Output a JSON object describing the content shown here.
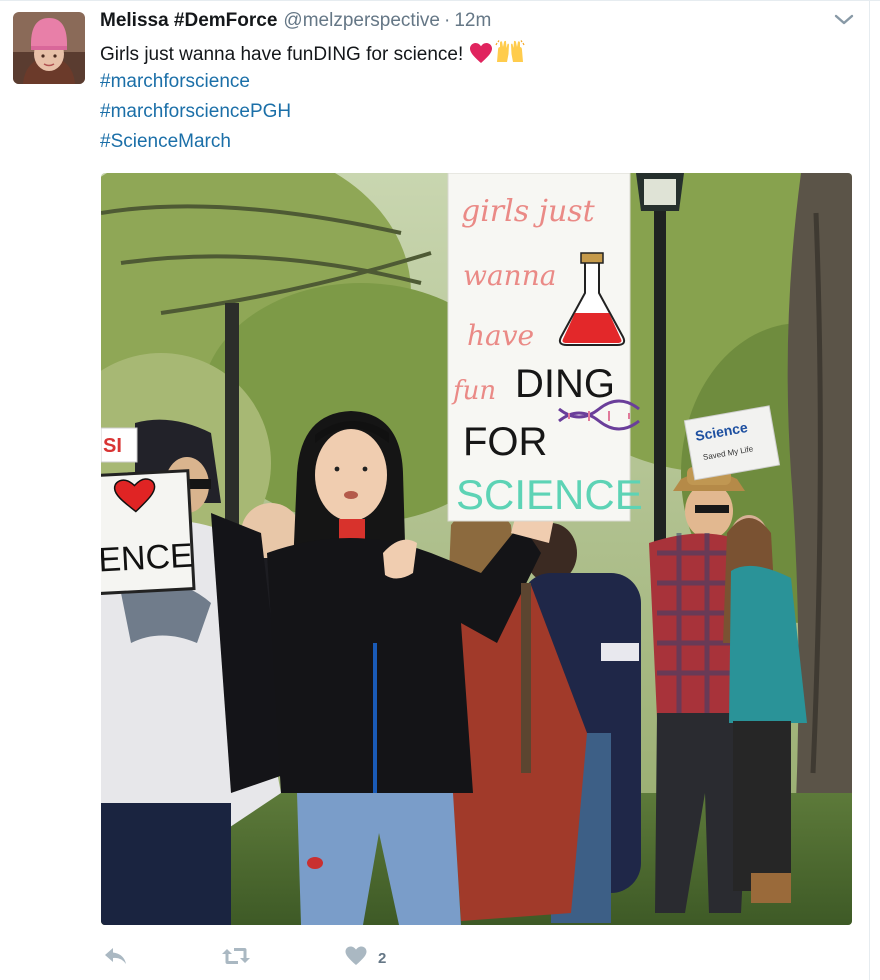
{
  "tweet": {
    "author_name": "Melissa #DemForce",
    "handle": "@melzperspective",
    "separator": "·",
    "time": "12m",
    "text": "Girls just wanna have funDING for science!",
    "emojis": [
      "red-heart-emoji",
      "raising-hands-emoji"
    ],
    "hashtags": [
      "#marchforscience",
      "#marchforsciencePGH",
      "#ScienceMarch"
    ],
    "like_count": "2"
  },
  "photo": {
    "center_sign": {
      "line1": "girls just",
      "line2": "wanna",
      "line3": "have",
      "line4a": "fun",
      "line4b": "DING",
      "line5": "FOR",
      "line6": "SCIENCE"
    },
    "left_sign": {
      "text": "ENCE"
    },
    "right_sign": {
      "line1": "Science",
      "line2": "Saved My Life"
    },
    "far_left_sign": {
      "text": "SI"
    }
  },
  "icons": {
    "reply": "reply-icon",
    "retweet": "retweet-icon",
    "like": "heart-icon",
    "more": "chevron-down-icon"
  },
  "colors": {
    "hashtag": "#1b6fa8",
    "secondary_text": "#657786",
    "action_icon": "#aab8c2",
    "heart_emoji": "#e0245e"
  }
}
